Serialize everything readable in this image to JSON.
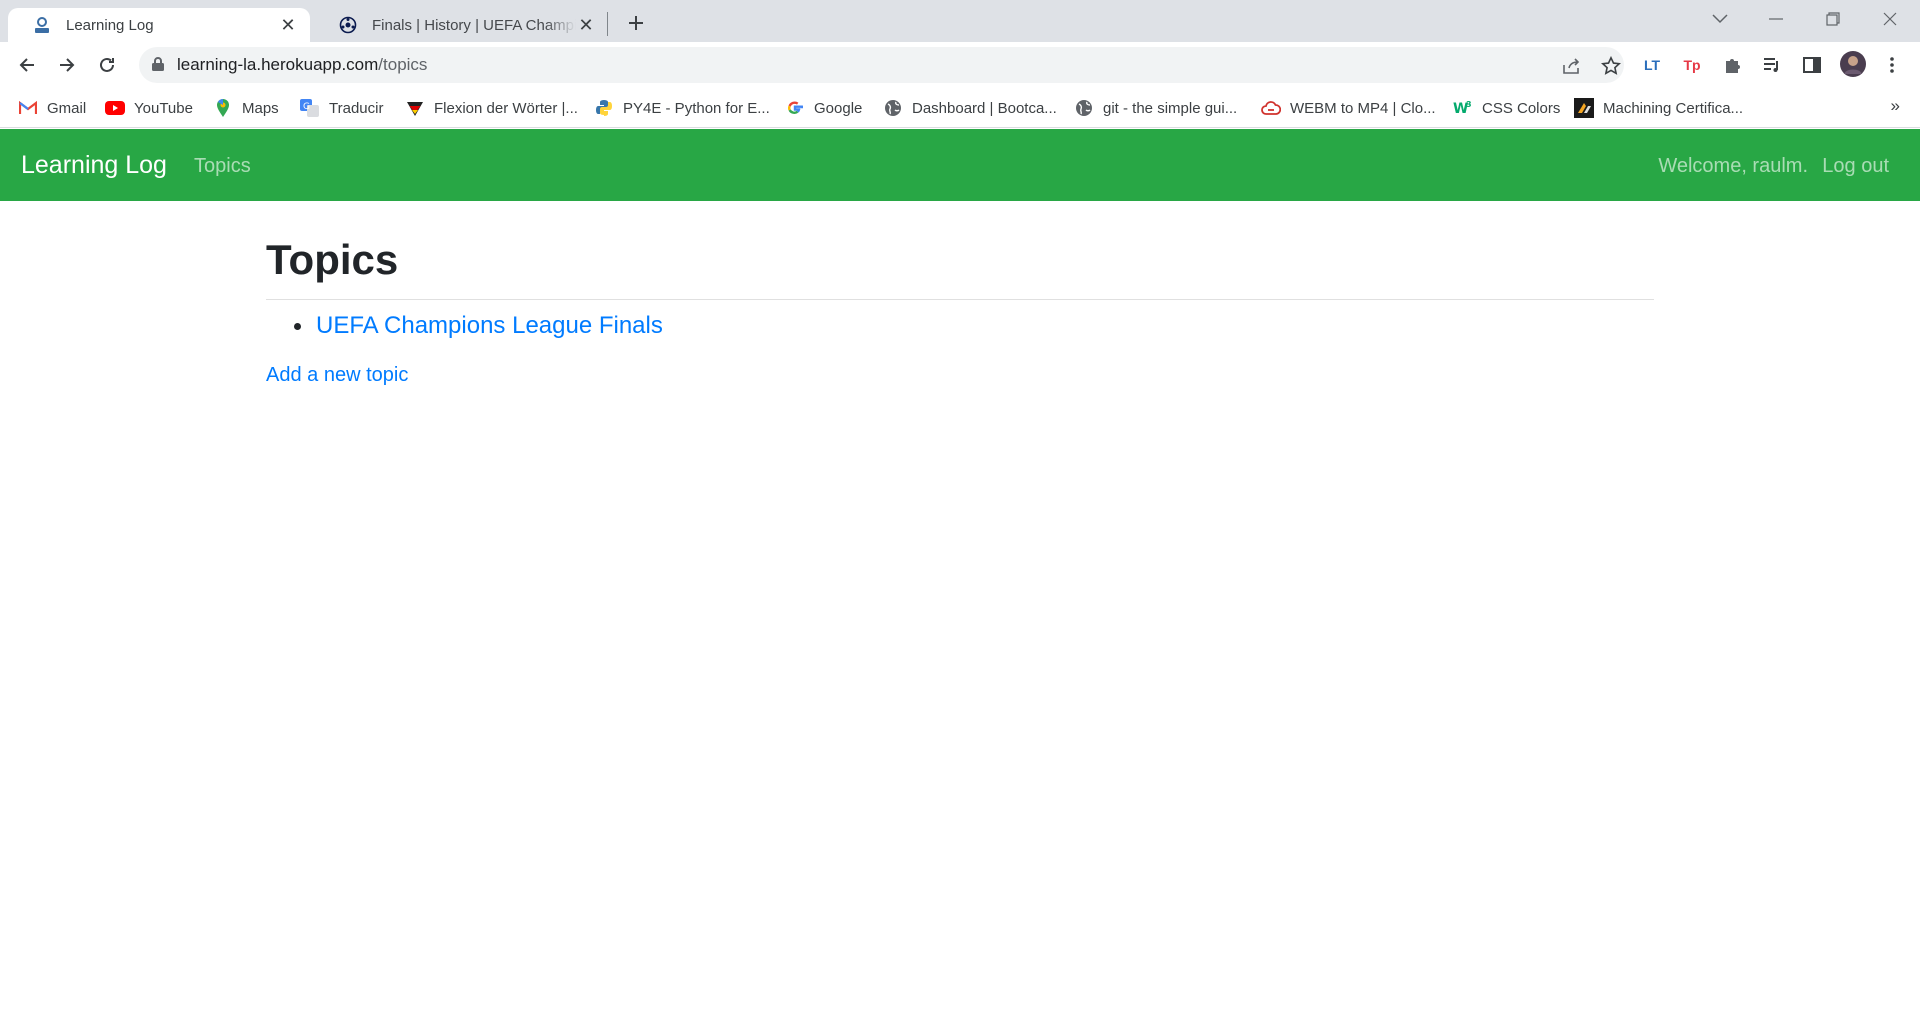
{
  "browser": {
    "tabs": [
      {
        "title": "Learning Log",
        "icon": "learning-log-favicon",
        "active": true
      },
      {
        "title": "Finals | History | UEFA Champions League",
        "icon": "uefa-ball-favicon",
        "active": false
      }
    ],
    "address": {
      "host": "learning-la.herokuapp.com",
      "path": "/topics"
    },
    "extensions": [
      {
        "name": "languagetool-icon",
        "label": "LT",
        "color": "#2a6ebb"
      },
      {
        "name": "tp-extension-icon",
        "label": "Tp",
        "color": "#e63946"
      }
    ],
    "bookmarks": [
      {
        "label": "Gmail",
        "icon": "gmail-icon"
      },
      {
        "label": "YouTube",
        "icon": "youtube-icon"
      },
      {
        "label": "Maps",
        "icon": "maps-pin-icon"
      },
      {
        "label": "Traducir",
        "icon": "translate-icon"
      },
      {
        "label": "Flexion der Wörter |...",
        "icon": "flexion-icon"
      },
      {
        "label": "PY4E - Python for E...",
        "icon": "python-icon"
      },
      {
        "label": "Google",
        "icon": "google-icon"
      },
      {
        "label": "Dashboard | Bootca...",
        "icon": "globe-icon"
      },
      {
        "label": "git - the simple gui...",
        "icon": "globe-icon"
      },
      {
        "label": "WEBM to MP4 | Clo...",
        "icon": "cloudconvert-icon"
      },
      {
        "label": "CSS Colors",
        "icon": "w3schools-icon"
      },
      {
        "label": "Machining Certifica...",
        "icon": "machining-icon"
      }
    ],
    "bookmarks_more": "»"
  },
  "site": {
    "brand": "Learning Log",
    "nav_topics": "Topics",
    "welcome": "Welcome, raulm.",
    "logout": "Log out",
    "accent_color": "#28a745",
    "link_color": "#007bff"
  },
  "main": {
    "title": "Topics",
    "topics": [
      "UEFA Champions League Finals"
    ],
    "add_link": "Add a new topic"
  }
}
